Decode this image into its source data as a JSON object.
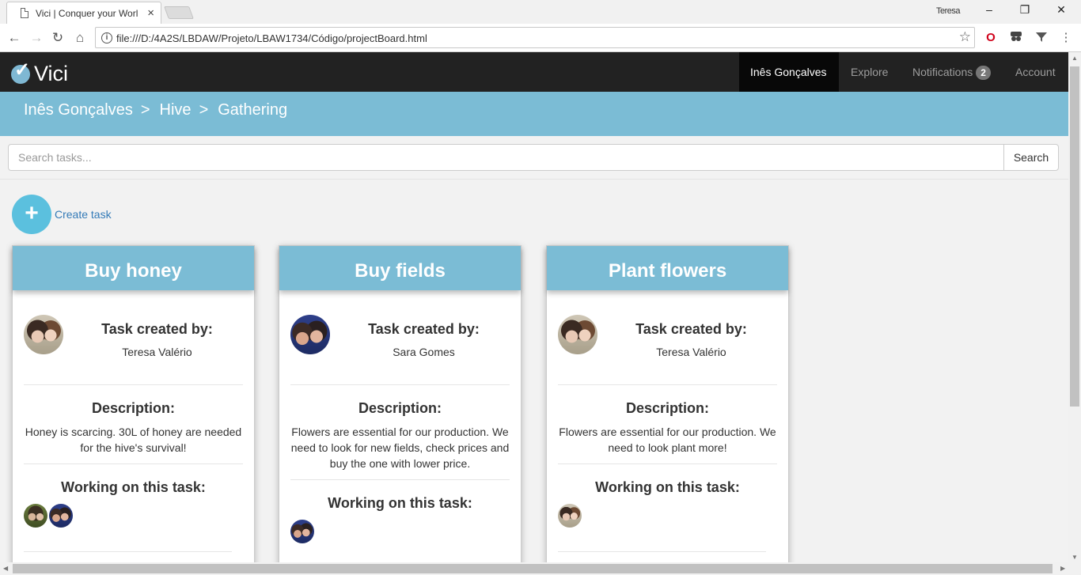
{
  "browser": {
    "tab_title": "Vici | Conquer your Worl",
    "tab_close": "×",
    "user_name": "Teresa",
    "url": "file:///D:/4A2S/LBDAW/Projeto/LBAW1734/Código/projectBoard.html",
    "window_controls": {
      "minimize": "–",
      "restore": "❐",
      "close": "✕"
    },
    "nav": {
      "back": "←",
      "forward": "→",
      "reload": "↻",
      "home": "⌂"
    },
    "info_glyph": "i",
    "star": "☆"
  },
  "navbar": {
    "brand": "Vici",
    "items": [
      {
        "label": "Inês Gonçalves",
        "active": true
      },
      {
        "label": "Explore",
        "active": false
      },
      {
        "label": "Notifications",
        "active": false,
        "badge": "2"
      },
      {
        "label": "Account",
        "active": false
      }
    ]
  },
  "breadcrumb": {
    "items": [
      "Inês Gonçalves",
      "Hive",
      "Gathering"
    ],
    "separator": ">"
  },
  "search": {
    "placeholder": "Search tasks...",
    "button_label": "Search"
  },
  "create_task": {
    "icon_glyph": "+",
    "label": "Create task"
  },
  "labels": {
    "created_by": "Task created by:",
    "description": "Description:",
    "working_on": "Working on this task:"
  },
  "cards": [
    {
      "title": "Buy honey",
      "creator": "Teresa Valério",
      "description": "Honey is scarcing. 30L of honey are needed for the hive's survival!"
    },
    {
      "title": "Buy fields",
      "creator": "Sara Gomes",
      "description": "Flowers are essential for our production. We need to look for new fields, check prices and buy the one with lower price."
    },
    {
      "title": "Plant flowers",
      "creator": "Teresa Valério",
      "description": "Flowers are essential for our production. We need to look plant more!"
    }
  ],
  "colors": {
    "navbar": "#222222",
    "accent": "#7bbcd5",
    "create_button": "#5bc0de",
    "link": "#337ab7"
  }
}
